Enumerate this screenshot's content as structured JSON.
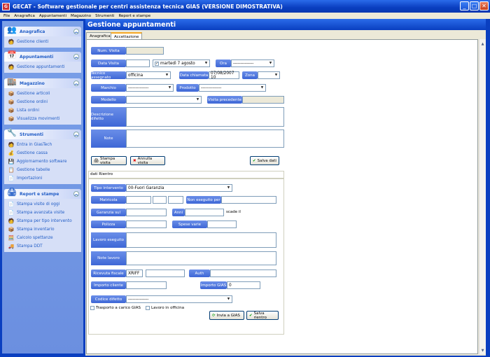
{
  "window": {
    "title": "GECAT - Software gestionale per centri assistenza tecnica GIAS  (VERSIONE DIMOSTRATIVA)",
    "min": "_",
    "max": "□",
    "close": "✕"
  },
  "menu": [
    "File",
    "Anagrafica",
    "Appuntamenti",
    "Magazzino",
    "Strumenti",
    "Report e stampe"
  ],
  "sidebar": [
    {
      "title": "Anagrafica",
      "items": [
        "Gestione clienti"
      ]
    },
    {
      "title": "Appuntamenti",
      "items": [
        "Gestione appuntamenti"
      ]
    },
    {
      "title": "Magazzino",
      "items": [
        "Gestione articoli",
        "Gestione ordini",
        "Lista ordini",
        "Visualizza movimenti"
      ]
    },
    {
      "title": "Strumenti",
      "items": [
        "Entra in GiasTech",
        "Gestione cassa",
        "Aggiornamento software",
        "Gestione tabelle",
        "Importazioni"
      ]
    },
    {
      "title": "Report e stampe",
      "items": [
        "Stampa visite di oggi",
        "Stampa avanzata visite",
        "Stampa per tipo intervento",
        "Stampa inventario",
        "Calcolo spettanze",
        "Stampa DDT"
      ]
    }
  ],
  "main": {
    "title": "Gestione appuntamenti",
    "tabs": [
      "Anagrafica",
      "Accettazione"
    ]
  },
  "form": {
    "num_visita": "Num. Visita",
    "data_visita": "Data Visita",
    "date_val": "martedì    7  agosto",
    "ora": "Ora",
    "ora_val": "--------------",
    "tecnico": "Tecnico assegnato",
    "tecnico_val": "officina",
    "data_chiamata": "Data chiamata",
    "data_chiamata_val": "07/08/2007 10",
    "zona": "Zona",
    "marchio": "Marchio",
    "marchio_val": "--------------",
    "prodotto": "Prodotto",
    "prodotto_val": "--------------",
    "modello": "Modello",
    "visita_prec": "Visita precedente",
    "desc": "Descrizione difetto",
    "note": "Note",
    "stampa_visita": "Stampa visita",
    "annulla_visita": "Annulla visita",
    "salva_dati": "Salva dati"
  },
  "rientro": {
    "title": "dati Rientro",
    "tipo": "Tipo intervento",
    "tipo_val": "00-Fuori Garanzia",
    "matricola": "Matricola",
    "non_eseguito": "Non eseguito per",
    "garanzia": "Garanzia sul",
    "anni": "Anni",
    "scade": "scade il",
    "polizza": "Polizza",
    "spese": "Spese varie",
    "lavoro": "Lavoro eseguito",
    "note_lavoro": "Note lavoro",
    "ricevuta": "Ricevuta fiscale",
    "ricevuta_val": "XRIFF",
    "auth": "Auth",
    "importo_cliente": "Importo cliente",
    "importo_gias": "Importo GIAS",
    "importo_gias_val": "0",
    "codice": "Codice difetto",
    "codice_val": "--------------",
    "trasporto": "Trasporto a carico GIAS",
    "lavoro_officina": "Lavoro in officina",
    "invia": "Invia a GIAS",
    "salva_rientro": "Salva rientro"
  }
}
